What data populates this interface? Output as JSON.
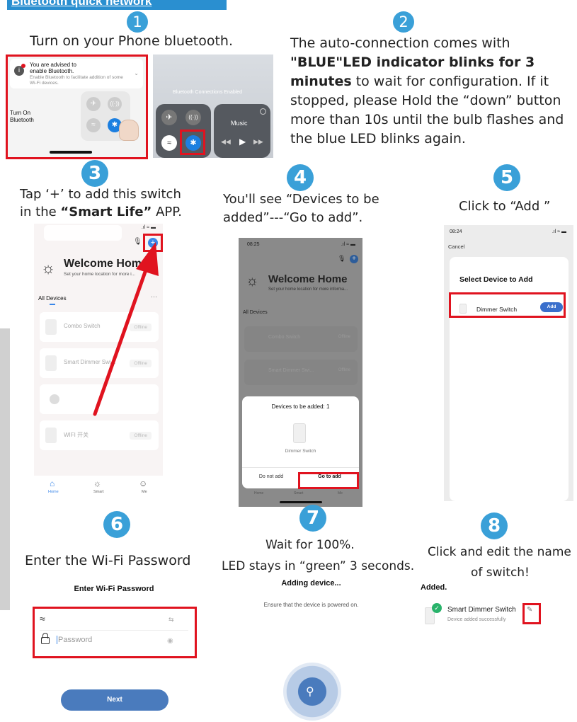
{
  "header": {
    "title": "Bluetooth quick network"
  },
  "steps": [
    {
      "num": "1",
      "text": "Turn on your Phone bluetooth."
    },
    {
      "num": "2",
      "text_bold_1": "\"BLUE\"LED indicator blinks for 3 minutes",
      "text_pre": "The auto-connection comes with",
      "text_post": " to wait for configuration. If it stopped, please Hold the “down” button more than 10s until the bulb flashes and the blue LED blinks again."
    },
    {
      "num": "3",
      "line1": "Tap ‘+’ to add this switch",
      "line2_pre": "in the ",
      "line2_bold": "“Smart Life”",
      "line2_post": " APP."
    },
    {
      "num": "4",
      "line1": "You'll see “Devices to be",
      "line2": "added”---“Go to add”."
    },
    {
      "num": "5",
      "text": "Click to “Add ”"
    },
    {
      "num": "6",
      "text": "Enter the Wi-Fi Password"
    },
    {
      "num": "7",
      "line1": "Wait for 100%.",
      "line2": "LED stays in “green” 3 seconds."
    },
    {
      "num": "8",
      "line1": "Click and edit the name",
      "line2": "of switch!"
    }
  ],
  "s1": {
    "notice_line1": "You are advised to",
    "notice_line2": "enable Bluetooth.",
    "notice_sub": "Enable Bluetooth to facilitate addition of some Wi-Fi devices.",
    "turn_on_label": "Turn On\nBluetooth",
    "cc_banner": "Bluetooth Connections Enabled",
    "music_label": "Music"
  },
  "s3": {
    "welcome": "Welcome Home",
    "location": "Set your home location for more i...",
    "all_devices": "All Devices",
    "more": "···",
    "devices": [
      {
        "name": "Combo Switch",
        "status": "Offline"
      },
      {
        "name": "Smart Dimmer Swi...",
        "status": "Offline"
      },
      {
        "name": "",
        "status": ""
      },
      {
        "name": "WIFI 开关",
        "status": "Offline"
      }
    ],
    "nav": [
      "Home",
      "Smart",
      "Me"
    ]
  },
  "s4": {
    "time": "08:25",
    "welcome": "Welcome Home",
    "location": "Set your home location for more informa...",
    "all_devices": "All Devices",
    "devices": [
      "Combo Switch",
      "Smart Dimmer Swi..."
    ],
    "statuses": [
      "Offline",
      "Offline"
    ],
    "modal_title": "Devices to be added: 1",
    "device_name": "Dimmer Switch",
    "do_not_add": "Do not add",
    "go_to_add": "Go to add",
    "nav": [
      "Home",
      "Smart",
      "Me"
    ]
  },
  "s5": {
    "time": "08:24",
    "cancel": "Cancel",
    "title": "Select Device to Add",
    "device": "Dimmer Switch",
    "add": "Add"
  },
  "s6": {
    "title": "Enter Wi-Fi Password",
    "password_placeholder": "Password",
    "next": "Next"
  },
  "s7": {
    "title": "Adding device...",
    "sub": "Ensure that the device is powered on."
  },
  "s8": {
    "added": "Added.",
    "device": "Smart Dimmer Switch",
    "sub": "Device added successfully"
  }
}
